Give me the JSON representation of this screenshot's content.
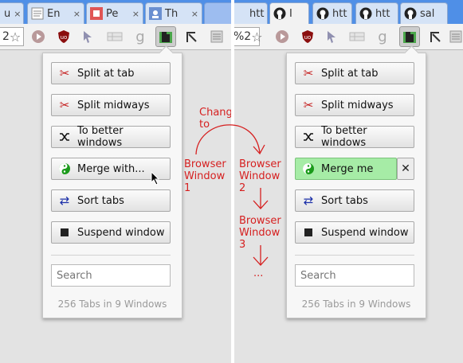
{
  "left": {
    "tabs": [
      {
        "label": "u",
        "icon": "page-icon",
        "close": "×"
      },
      {
        "label": "En",
        "icon": "wiki-icon",
        "close": "×"
      },
      {
        "label": "Pe",
        "icon": "pe-icon",
        "close": "×"
      },
      {
        "label": "Th",
        "icon": "th-icon",
        "close": "×"
      }
    ],
    "omnibox": "2",
    "popup": {
      "buttons": [
        "Split at tab",
        "Split midways",
        "To better windows",
        "Merge with...",
        "Sort tabs",
        "Suspend window"
      ],
      "search_placeholder": "Search",
      "status": "256 Tabs in 9 Windows"
    }
  },
  "right": {
    "tabs": [
      {
        "label": "htt",
        "icon": "page-icon",
        "close": "×"
      },
      {
        "label": "I",
        "icon": "github-icon",
        "close": "×"
      },
      {
        "label": "htt",
        "icon": "github-icon",
        "close": "×"
      },
      {
        "label": "htt",
        "icon": "github-icon",
        "close": "×"
      },
      {
        "label": "sal",
        "icon": "github-icon",
        "close": "×"
      }
    ],
    "omnibox": "%2",
    "popup": {
      "buttons": [
        "Split at tab",
        "Split midways",
        "To better windows",
        "Merge me",
        "Sort tabs",
        "Suspend window"
      ],
      "close_symbol": "✕",
      "search_placeholder": "Search",
      "status": "256 Tabs in 9 Windows"
    }
  },
  "annotation": {
    "title": "Change to",
    "window1": [
      "Browser",
      "Window",
      "1"
    ],
    "window2": [
      "Browser",
      "Window",
      "2"
    ],
    "window3": [
      "Browser",
      "Window",
      "3"
    ],
    "ellipsis": "..."
  },
  "colors": {
    "tabstrip": "#4f8fe7",
    "annotation": "#d62020",
    "merge_me_bg": "#a6eca6"
  }
}
